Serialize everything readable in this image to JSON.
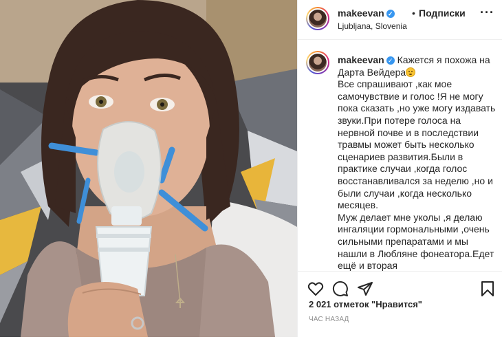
{
  "header": {
    "username": "makeevan",
    "verified_mark": "✓",
    "separator": "•",
    "follow_label": "Подписки",
    "location": "Ljubljana, Slovenia",
    "more_label": "···"
  },
  "photo": {
    "description_icon": "selfie-with-nebulizer-mask"
  },
  "caption": {
    "username": "makeevan",
    "verified_mark": "✓",
    "text_lead": "Кажется я похожа на Дарта Вейдера",
    "emoji_icon": "slightly-frowning-face-emoji",
    "body": "Все спрашивают ,как мое самочувствие и голос !Я не могу пока сказать ,но уже могу издавать звуки.При потере голоса на нервной почве и в последствии травмы может быть несколько сценариев развития.Были в практике случаи ,когда голос восстанавливался за неделю ,но и были случаи ,когда несколько месяцев.",
    "body2": "Муж делает мне уколы ,я делаю ингаляции гормональными ,очень сильными препаратами и мы нашли в Любляне фонеатора.Едет ещё и вторая исполнительница,поэтому пока большой вопрос выйду ли я на сцену или нет"
  },
  "actions": {
    "like_icon": "heart-icon",
    "comment_icon": "comment-icon",
    "share_icon": "paper-plane-icon",
    "save_icon": "bookmark-icon",
    "likes_text": "2 021 отметок \"Нравится\"",
    "time_text": "ЧАС НАЗАД"
  },
  "colors": {
    "verified": "#3897f0",
    "text": "#262626",
    "muted": "#8e8e8e",
    "border": "#efefef"
  }
}
